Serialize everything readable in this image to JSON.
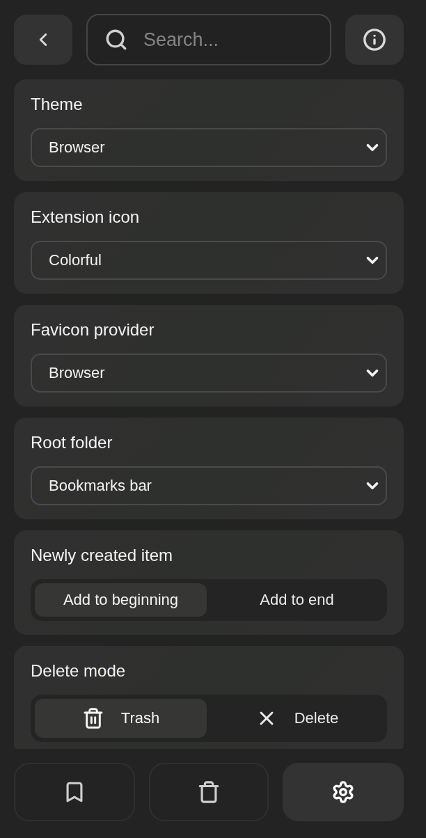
{
  "search": {
    "placeholder": "Search..."
  },
  "settings": [
    {
      "kind": "select",
      "label": "Theme",
      "value": "Browser"
    },
    {
      "kind": "select",
      "label": "Extension icon",
      "value": "Colorful"
    },
    {
      "kind": "select",
      "label": "Favicon provider",
      "value": "Browser"
    },
    {
      "kind": "select",
      "label": "Root folder",
      "value": "Bookmarks bar"
    },
    {
      "kind": "segmented",
      "label": "Newly created item",
      "options": [
        {
          "label": "Add to beginning",
          "selected": true
        },
        {
          "label": "Add to end",
          "selected": false
        }
      ]
    },
    {
      "kind": "segmented",
      "label": "Delete mode",
      "options": [
        {
          "kind": "trash",
          "label": "Trash",
          "selected": true
        },
        {
          "kind": "close",
          "label": "Delete",
          "selected": false
        }
      ]
    }
  ],
  "nav": [
    {
      "kind": "bookmarks",
      "selected": false
    },
    {
      "kind": "trash",
      "selected": false
    },
    {
      "kind": "settings",
      "selected": true
    }
  ]
}
